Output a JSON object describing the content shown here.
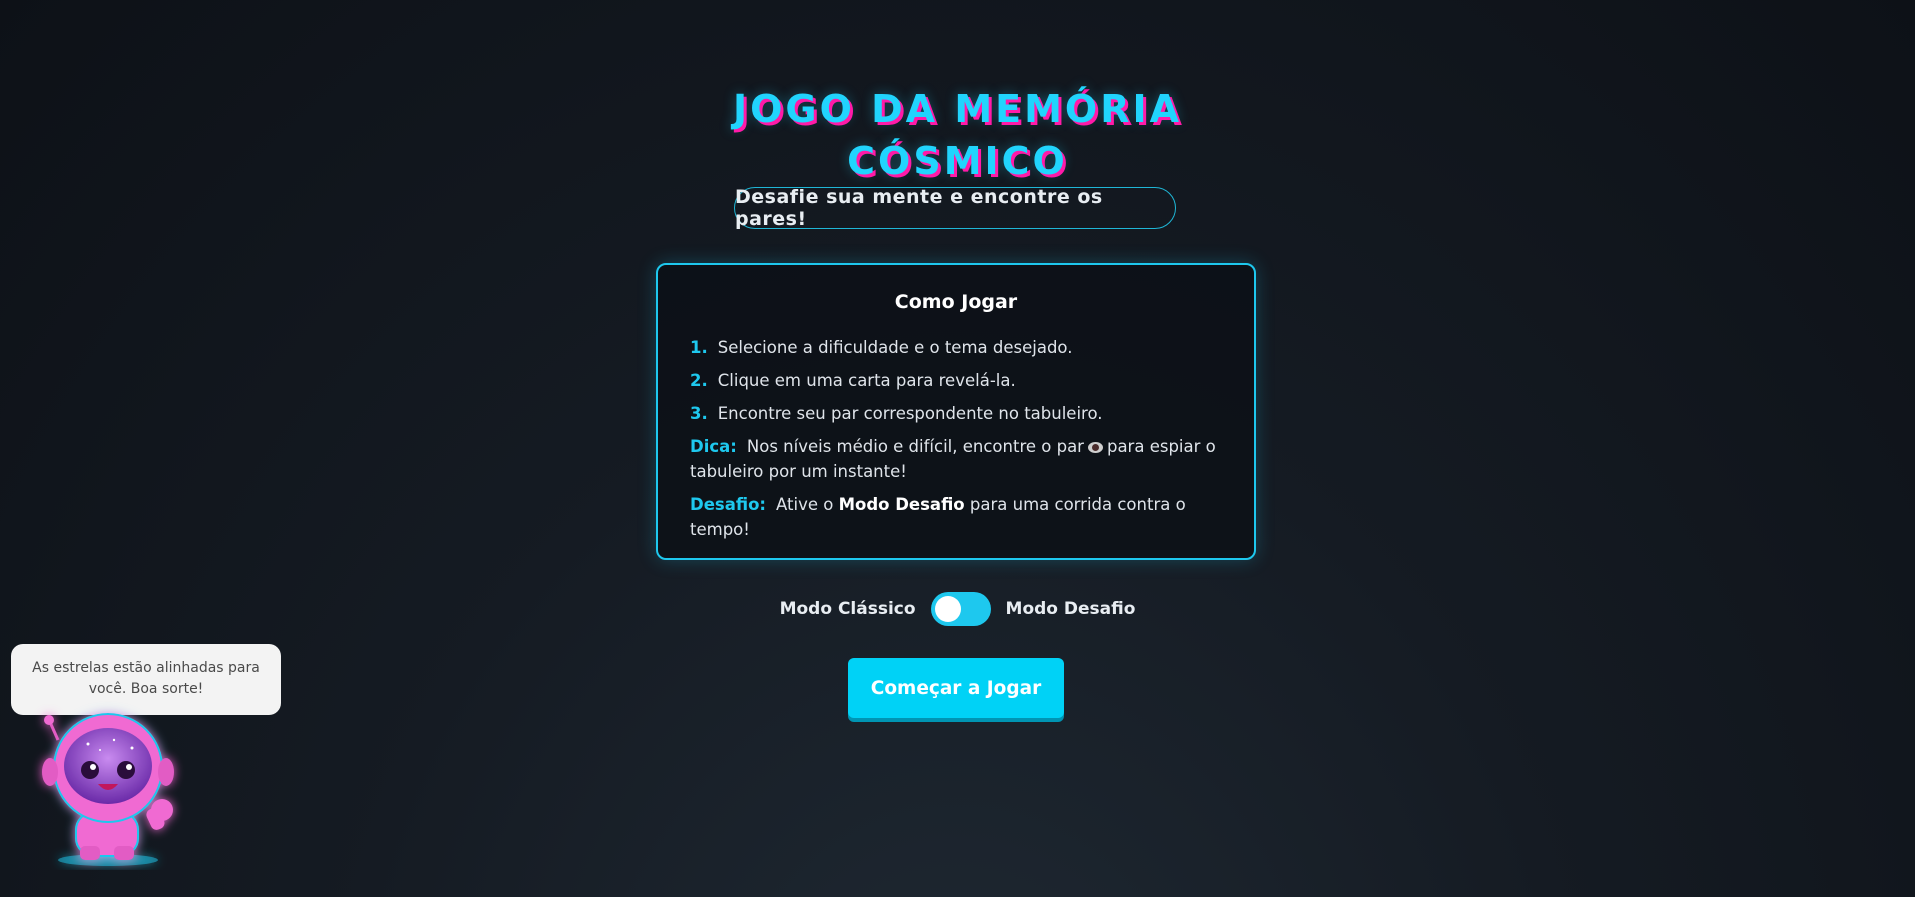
{
  "title": {
    "line1": "JOGO DA MEMÓRIA",
    "line2": "CÓSMICO"
  },
  "subtitle": "Desafie sua mente e encontre os pares!",
  "how_to": {
    "heading": "Como Jogar",
    "steps": [
      {
        "num": "1.",
        "text": "Selecione a dificuldade e o tema desejado."
      },
      {
        "num": "2.",
        "text": "Clique em uma carta para revelá-la."
      },
      {
        "num": "3.",
        "text": "Encontre seu par correspondente no tabuleiro."
      }
    ],
    "tip": {
      "label": "Dica:",
      "text_before": "Nos níveis médio e difícil, encontre o par",
      "icon": "eye-icon",
      "text_after": "para espiar o tabuleiro por um instante!"
    },
    "challenge": {
      "label": "Desafio:",
      "text_before": "Ative o",
      "bold": "Modo Desafio",
      "text_after": "para uma corrida contra o tempo!"
    }
  },
  "mode": {
    "left_label": "Modo Clássico",
    "right_label": "Modo Desafio",
    "challenge_enabled": false
  },
  "start_button": "Começar a Jogar",
  "mascot": {
    "speech": "As estrelas estão alinhadas para você. Boa sorte!",
    "icon": "astronaut-alien-icon"
  },
  "colors": {
    "accent": "#1ec8ee",
    "title_shadow": "#ff1aa8",
    "button": "#00d2f6"
  }
}
